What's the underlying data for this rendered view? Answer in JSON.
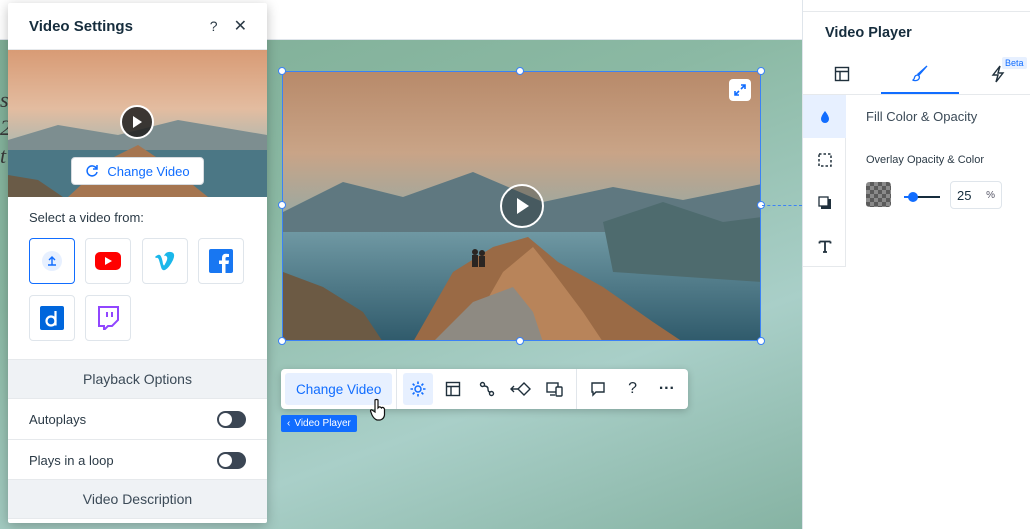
{
  "canvas": {
    "bg_text": "s 2 t",
    "video_tag_label": "Video Player",
    "toolbar": {
      "change_video_label": "Change Video",
      "icons": [
        "settings-gear-icon",
        "layout-icon",
        "animation-icon",
        "navigate-icon",
        "mobile-layout-icon",
        "comment-icon",
        "help-icon",
        "more-icon"
      ],
      "help_glyph": "?",
      "more_glyph": "···"
    }
  },
  "settings_panel": {
    "title": "Video Settings",
    "help": "?",
    "close": "✕",
    "change_video_label": "Change Video",
    "select_label": "Select a video from:",
    "sources": [
      "upload",
      "YouTube",
      "Vimeo",
      "Facebook",
      "Dailymotion",
      "Twitch"
    ],
    "playback_header": "Playback Options",
    "autoplays_label": "Autoplays",
    "loop_label": "Plays in a loop",
    "autoplays": false,
    "loop": false,
    "description_header": "Video Description"
  },
  "inspector": {
    "title": "Video Player",
    "beta": "Beta",
    "tabs": [
      "layout-tab",
      "design-tab",
      "interactions-tab"
    ],
    "active_tab": "design-tab",
    "section_title": "Fill Color & Opacity",
    "subtitle": "Overlay Opacity & Color",
    "opacity_value": "25",
    "opacity_unit": "%",
    "opacity_fraction": 0.25
  },
  "colors": {
    "accent": "#116dff",
    "selection": "#3b82f6",
    "youtube": "#ff0000",
    "vimeo": "#1ab7ea",
    "facebook": "#1877f2",
    "dailymotion": "#0066dc",
    "twitch": "#9146ff"
  }
}
